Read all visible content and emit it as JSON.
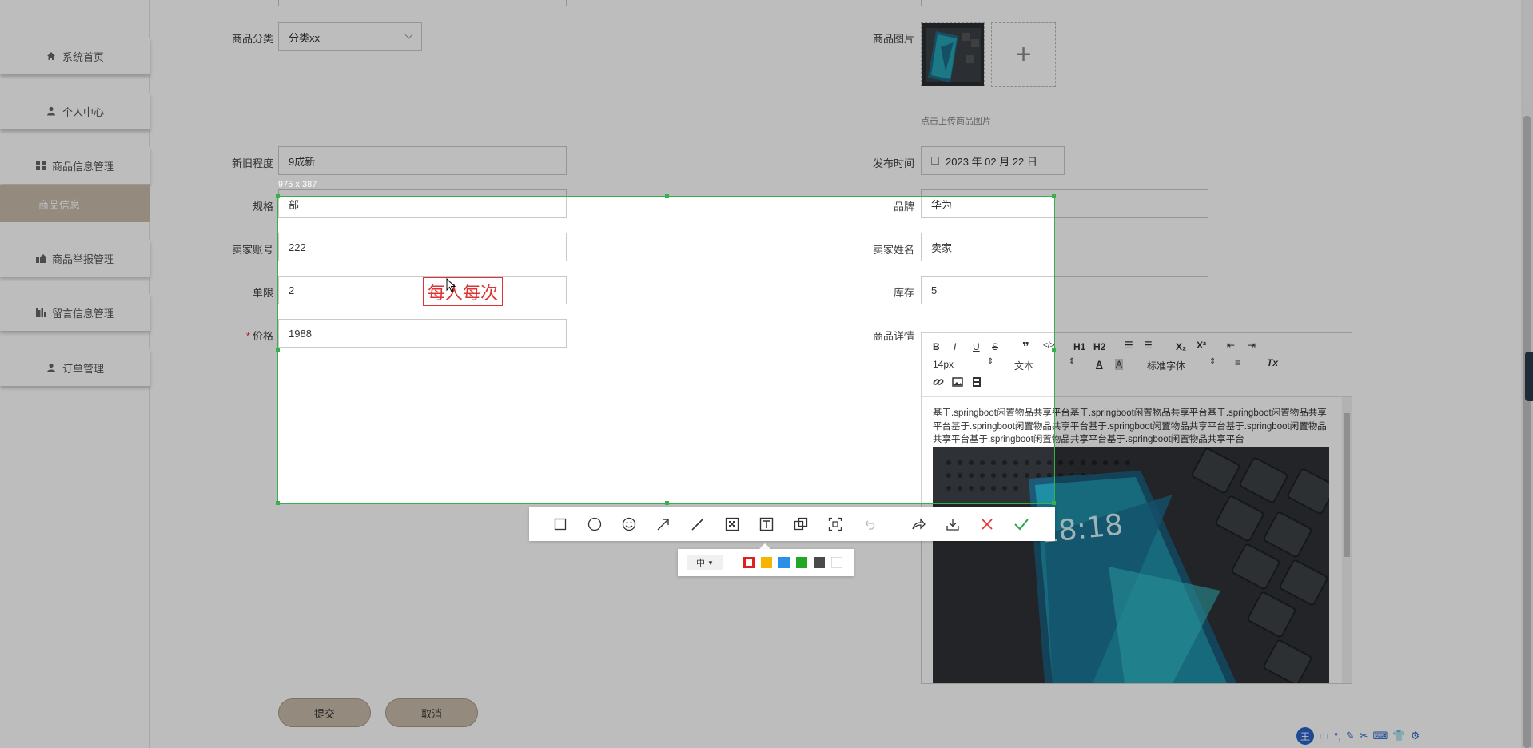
{
  "sidebar": {
    "items": [
      {
        "label": "系统首页",
        "icon": "home-icon"
      },
      {
        "label": "个人中心",
        "icon": "user-icon"
      },
      {
        "label": "商品信息管理",
        "icon": "grid-icon"
      },
      {
        "label": "商品举报管理",
        "icon": "report-icon"
      },
      {
        "label": "留言信息管理",
        "icon": "chart-icon"
      },
      {
        "label": "订单管理",
        "icon": "user-icon"
      }
    ],
    "sub_item": "商品信息"
  },
  "form": {
    "category": {
      "label": "商品分类",
      "value": "分类xx"
    },
    "image": {
      "label": "商品图片",
      "hint": "点击上传商品图片"
    },
    "condition": {
      "label": "新旧程度",
      "value": "9成新"
    },
    "publish_time": {
      "label": "发布时间",
      "value": "2023 年 02 月 22 日"
    },
    "spec": {
      "label": "规格",
      "value": "部"
    },
    "brand": {
      "label": "品牌",
      "value": "华为"
    },
    "seller_account": {
      "label": "卖家账号",
      "value": "222"
    },
    "seller_name": {
      "label": "卖家姓名",
      "value": "卖家"
    },
    "limit": {
      "label": "单限",
      "value": "2"
    },
    "stock": {
      "label": "库存",
      "value": "5"
    },
    "price": {
      "label": "价格",
      "value": "1988",
      "required_mark": "*"
    },
    "detail": {
      "label": "商品详情"
    }
  },
  "editor": {
    "toolbar": {
      "font_size": "14px",
      "text_style": "文本",
      "font_family": "标准字体",
      "h1": "H1",
      "h2": "H2"
    },
    "content": "基于.springboot闲置物品共享平台基于.springboot闲置物品共享平台基于.springboot闲置物品共享平台基于.springboot闲置物品共享平台基于.springboot闲置物品共享平台基于.springboot闲置物品共享平台基于.springboot闲置物品共享平台基于.springboot闲置物品共享平台"
  },
  "buttons": {
    "submit": "提交",
    "cancel": "取消"
  },
  "screenshot_tool": {
    "size_label": "975 x 387",
    "annotation_text": "每人每次",
    "size_option": "中",
    "colors": [
      "#e02020",
      "#f5b400",
      "#2b8fe6",
      "#23a623",
      "#4a4a4a",
      "#ffffff"
    ]
  },
  "ime": {
    "mode": "中"
  }
}
